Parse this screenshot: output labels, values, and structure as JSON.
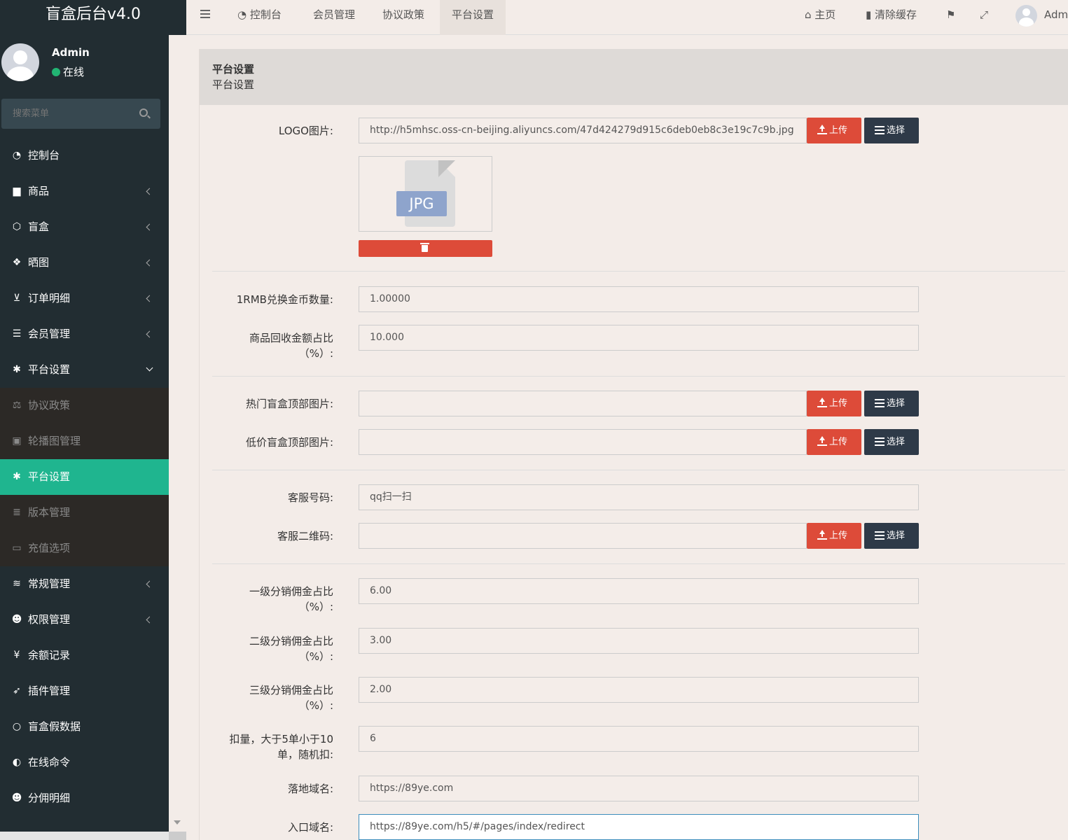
{
  "brand": "盲盒后台v4.0",
  "user": {
    "name": "Admin",
    "status": "在线"
  },
  "search": {
    "placeholder": "搜索菜单"
  },
  "menu": {
    "dashboard": "控制台",
    "goods": "商品",
    "blindbox": "盲盒",
    "showcase": "晒图",
    "orders": "订单明细",
    "members": "会员管理",
    "platform": "平台设置",
    "sub": {
      "agreement": "协议政策",
      "banner": "轮播图管理",
      "platform": "平台设置",
      "version": "版本管理",
      "recharge": "充值选项"
    },
    "general": "常规管理",
    "auth": "权限管理",
    "balance": "余额记录",
    "plugins": "插件管理",
    "fakedata": "盲盒假数据",
    "command": "在线命令",
    "commission": "分佣明细"
  },
  "navbar": {
    "tabs": [
      "控制台",
      "会员管理",
      "协议政策",
      "平台设置"
    ],
    "home": "主页",
    "clear_cache": "清除缓存",
    "user_short": "Adm"
  },
  "panel": {
    "title": "平台设置",
    "subtitle": "平台设置"
  },
  "buttons": {
    "upload": "上传",
    "choose": "选择"
  },
  "thumb": {
    "ext": "JPG"
  },
  "form": {
    "logo": {
      "label": "LOGO图片:",
      "value": "http://h5mhsc.oss-cn-beijing.aliyuncs.com/47d424279d915c6deb0eb8c3e19c7c9b.jpg"
    },
    "rate": {
      "label": "1RMB兑换金币数量:",
      "value": "1.00000"
    },
    "recycle": {
      "label": "商品回收金额占比（%）:",
      "value": "10.000"
    },
    "hot_top": {
      "label": "热门盲盒顶部图片:",
      "value": ""
    },
    "cheap_top": {
      "label": "低价盲盒顶部图片:",
      "value": ""
    },
    "service_no": {
      "label": "客服号码:",
      "value": "qq扫一扫"
    },
    "service_qr": {
      "label": "客服二维码:",
      "value": ""
    },
    "level1": {
      "label": "一级分销佣金占比（%）:",
      "value": "6.00"
    },
    "level2": {
      "label": "二级分销佣金占比（%）:",
      "value": "3.00"
    },
    "level3": {
      "label": "三级分销佣金占比（%）:",
      "value": "2.00"
    },
    "deduct": {
      "label": "扣量，大于5单小于10单，随机扣:",
      "value": "6"
    },
    "landing": {
      "label": "落地域名:",
      "value": "https://89ye.com"
    },
    "entry": {
      "label": "入口域名:",
      "value": "https://89ye.com/h5/#/pages/index/redirect"
    }
  }
}
